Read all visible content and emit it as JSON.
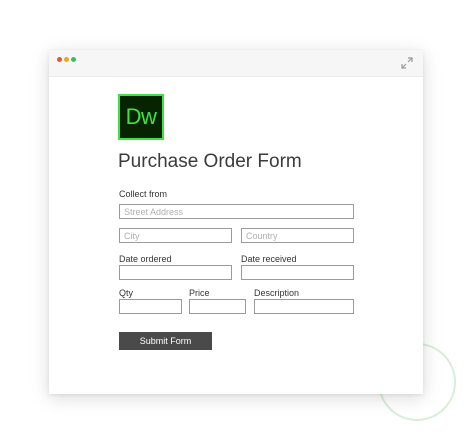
{
  "app": {
    "logo_text": "Dw",
    "logo_colors": {
      "background": "#072401",
      "accent": "#3fe23f"
    }
  },
  "window": {
    "controls": [
      "close-dot",
      "minimize-dot",
      "maximize-dot"
    ],
    "expand_icon": "expand-arrows-icon"
  },
  "form": {
    "title": "Purchase Order Form",
    "collect_from_label": "Collect from",
    "street_placeholder": "Street Address",
    "city_placeholder": "City",
    "country_placeholder": "Country",
    "date_ordered_label": "Date ordered",
    "date_received_label": "Date received",
    "qty_label": "Qty",
    "price_label": "Price",
    "description_label": "Description",
    "submit_label": "Submit Form"
  }
}
